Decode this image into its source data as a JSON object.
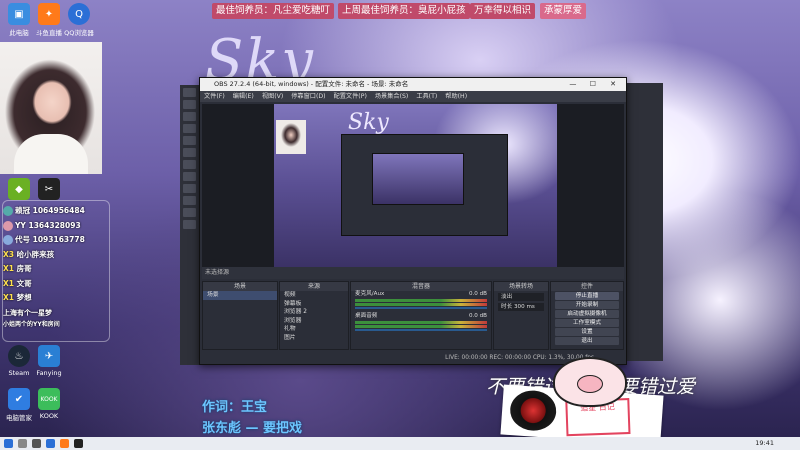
{
  "banner": {
    "item1": "最佳饲养员：凡尘爱吃糖叮",
    "item2": "上周最佳饲养员：臭屁小屁孩",
    "item3": "万幸得以相识",
    "item4": "承蒙厚爱"
  },
  "wallpaper": {
    "title": "Sky"
  },
  "desktop_icons": [
    {
      "label": "此电脑",
      "color": "#3a8de0"
    },
    {
      "label": "斗鱼直播",
      "color": "#ff7a1a"
    },
    {
      "label": "QQ浏览器",
      "color": "#2b6fd6"
    },
    {
      "label": "GeForce",
      "color": "#6ab023"
    },
    {
      "label": "剪映",
      "color": "#222222"
    },
    {
      "label": "Steam",
      "color": "#1b2838"
    },
    {
      "label": "Fanying",
      "color": "#2a7fd4"
    },
    {
      "label": "电脑管家",
      "color": "#2f7de1"
    },
    {
      "label": "KOOK",
      "color": "#3cbd5b"
    }
  ],
  "chat": [
    {
      "level": "X3",
      "text": "赖冠 1064956484",
      "color": "#6ab"
    },
    {
      "level": "YY",
      "text": "YY 1364328093",
      "color": "#d9a"
    },
    {
      "level": "",
      "text": "代号 1093163778",
      "color": "#8ad"
    },
    {
      "level": "X3",
      "text": "哈小胖来孩",
      "color": "#aa7"
    },
    {
      "level": "X1",
      "text": "房哥",
      "color": "#7ad"
    },
    {
      "level": "X1",
      "text": "文哥",
      "color": "#da7"
    },
    {
      "level": "X1",
      "text": "梦想",
      "color": "#7d9"
    }
  ],
  "chat_footer": {
    "line1": "上海有个一星梦",
    "line2": "小姐两个的YY和房间"
  },
  "obs": {
    "title": "OBS 27.2.4 (64-bit, windows) - 配置文件: 未命名 - 场景: 未命名",
    "menu": [
      "文件(F)",
      "编辑(E)",
      "视图(V)",
      "停靠窗口(D)",
      "配置文件(P)",
      "场景集合(S)",
      "工具(T)",
      "帮助(H)"
    ],
    "docks_header": "未选择源",
    "scenes": {
      "title": "场景",
      "items": [
        "场景"
      ]
    },
    "sources": {
      "title": "来源",
      "items": [
        "视频",
        "弹幕板",
        "浏览器 2",
        "浏览器",
        "礼物",
        "图片"
      ]
    },
    "mixer": {
      "title": "混音器",
      "tracks": [
        {
          "name": "麦克风/Aux",
          "db": "0.0 dB"
        },
        {
          "name": "桌面音频",
          "db": "0.0 dB"
        }
      ]
    },
    "transitions": {
      "title": "场景转场",
      "type": "淡出",
      "duration_label": "时长",
      "duration": "300 ms"
    },
    "controls": {
      "title": "控件",
      "buttons": [
        "停止直播",
        "开始录制",
        "启动虚拟摄像机",
        "工作室模式",
        "设置",
        "退出"
      ]
    },
    "status": "LIVE: 00:00:00   REC: 00:00:00   CPU: 1.3%, 30.00 fps"
  },
  "lyrics": {
    "credit": "作词：王宝",
    "line": "张东彪 — 要把戏"
  },
  "overlay_text": "不要错过，更不要错过爱",
  "card_stamp": "追星\n日记",
  "taskbar": {
    "clock": "19:41"
  }
}
